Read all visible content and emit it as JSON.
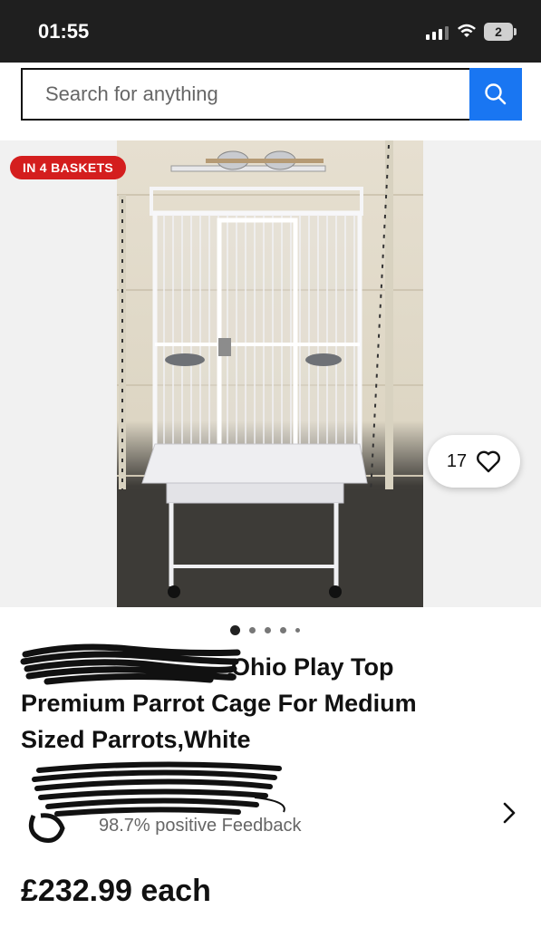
{
  "status_bar": {
    "time": "01:55",
    "battery": "2"
  },
  "search": {
    "placeholder": "Search for anything"
  },
  "gallery": {
    "badge": "IN 4 BASKETS",
    "watchers": "17",
    "image_description": "White parrot cage with play top",
    "dots_total": 5,
    "dots_active": 1
  },
  "listing": {
    "title_line1": "Ohio Play Top",
    "title_line2": "Premium Parrot Cage For Medium",
    "title_line3": "Sized Parrots,White",
    "seller_feedback": "98.7% positive Feedback",
    "price": "£232.99 each"
  },
  "colors": {
    "accent": "#1976f2",
    "badge": "#d41e1e",
    "status_bar": "#1f1f1f"
  }
}
